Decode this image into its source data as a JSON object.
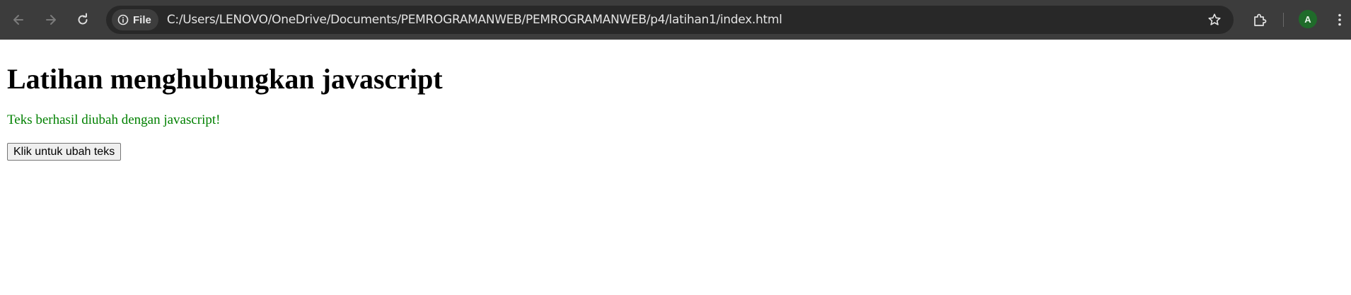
{
  "browser": {
    "site_chip_label": "File",
    "url": "C:/Users/LENOVO/OneDrive/Documents/PEMROGRAMANWEB/PEMROGRAMANWEB/p4/latihan1/index.html",
    "avatar_letter": "A",
    "icons": [
      "back-icon",
      "forward-icon",
      "reload-icon",
      "info-icon",
      "star-icon",
      "extensions-icon",
      "menu-icon"
    ]
  },
  "page": {
    "heading": "Latihan menghubungkan javascript",
    "message": "Teks berhasil diubah dengan javascript!",
    "button_label": "Klik untuk ubah teks"
  },
  "colors": {
    "toolbar_bg": "#3c3c3c",
    "omnibox_bg": "#282828",
    "message_color": "#008000",
    "avatar_bg": "#1f6b2a"
  }
}
